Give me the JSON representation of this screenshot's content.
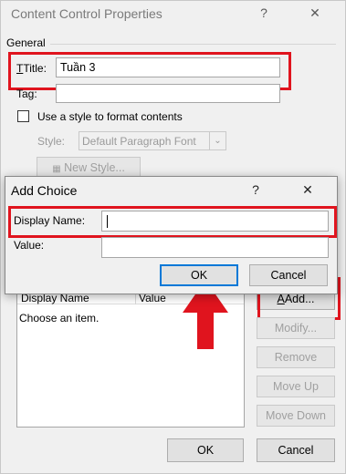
{
  "window": {
    "title": "Content Control Properties",
    "help_glyph": "?",
    "close_glyph": "✕"
  },
  "general": {
    "group_label": "General",
    "title_label": "Title:",
    "title_value": "Tuần 3",
    "tag_label": "Tag:",
    "tag_value": "",
    "use_style_label": "Use a style to format contents",
    "style_label": "Style:",
    "style_value": "Default Paragraph Font",
    "new_style_label": "New Style..."
  },
  "list_props": {
    "col_display_name": "Display Name",
    "col_value": "Value",
    "items": [
      {
        "display_name": "Choose an item.",
        "value": ""
      }
    ],
    "add_label": "Add...",
    "modify_label": "Modify...",
    "remove_label": "Remove",
    "move_up_label": "Move Up",
    "move_down_label": "Move Down"
  },
  "footer": {
    "ok_label": "OK",
    "cancel_label": "Cancel"
  },
  "add_choice": {
    "title": "Add Choice",
    "help_glyph": "?",
    "close_glyph": "✕",
    "display_name_label": "Display Name:",
    "display_name_value": "",
    "value_label": "Value:",
    "value_value": "",
    "ok_label": "OK",
    "cancel_label": "Cancel"
  },
  "colors": {
    "highlight": "#e0141e",
    "ok_focus": "#0078d7"
  }
}
